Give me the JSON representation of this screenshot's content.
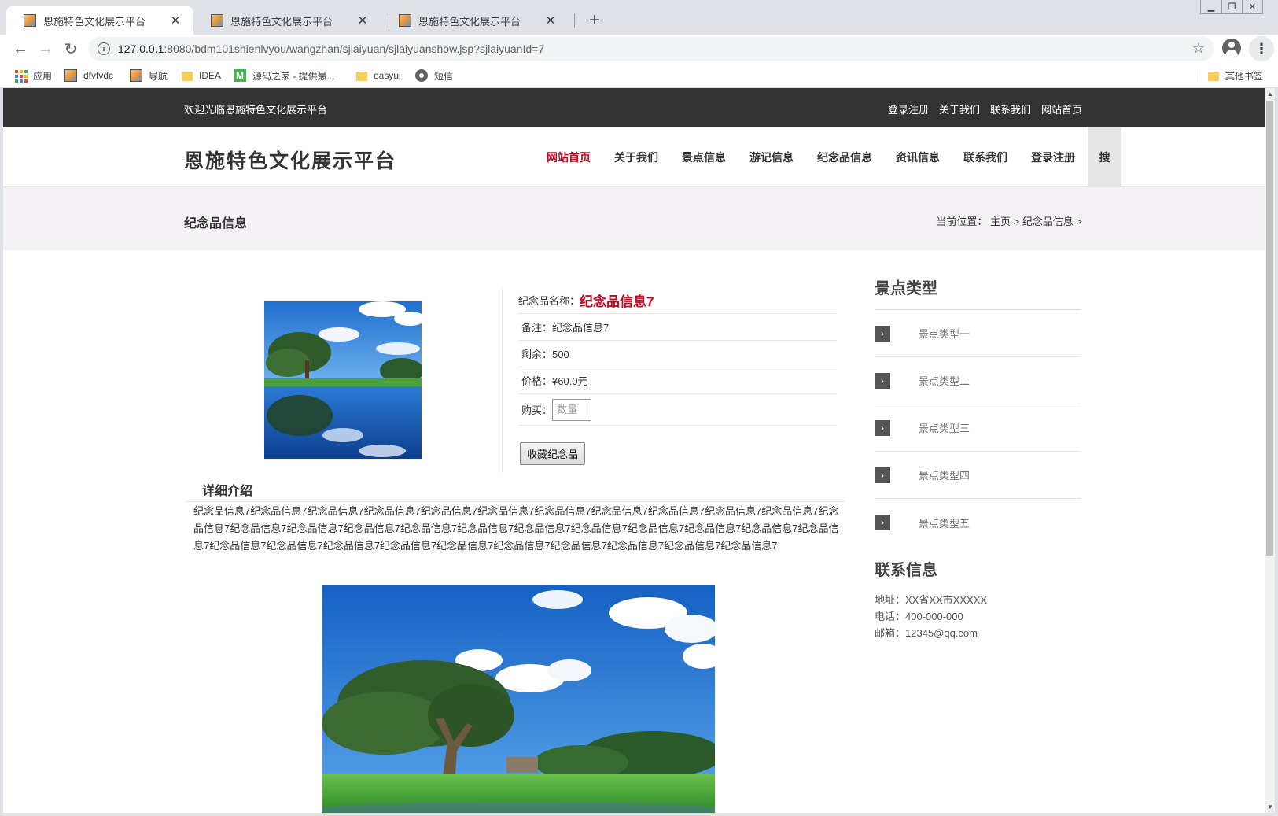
{
  "browser": {
    "tabs": [
      {
        "title": "恩施特色文化展示平台"
      },
      {
        "title": "恩施特色文化展示平台"
      },
      {
        "title": "恩施特色文化展示平台"
      }
    ],
    "url_host": "127.0.0.1",
    "url_rest": ":8080/bdm101shienlvyou/wangzhan/sjlaiyuan/sjlaiyuanshow.jsp?sjlaiyuanId=7",
    "bookmarks": [
      {
        "label": "应用",
        "icon": "apps-icon"
      },
      {
        "label": "dfvfvdc",
        "icon": "image-icon"
      },
      {
        "label": "导航",
        "icon": "image-icon"
      },
      {
        "label": "IDEA",
        "icon": "folder-icon"
      },
      {
        "label": "源码之家 - 提供最...",
        "icon": "m-icon"
      },
      {
        "label": "easyui",
        "icon": "folder-icon"
      },
      {
        "label": "短信",
        "icon": "globe-icon"
      }
    ],
    "other_bookmarks": "其他书签"
  },
  "topbar": {
    "welcome": "欢迎光临恩施特色文化展示平台",
    "links": [
      "登录注册",
      "关于我们",
      "联系我们",
      "网站首页"
    ]
  },
  "header": {
    "logo": "恩施特色文化展示平台",
    "nav": [
      "网站首页",
      "关于我们",
      "景点信息",
      "游记信息",
      "纪念品信息",
      "资讯信息",
      "联系我们",
      "登录注册"
    ],
    "active_nav": "网站首页",
    "search_label": "搜"
  },
  "banner": {
    "title": "纪念品信息",
    "breadcrumb": "当前位置： 主页 > 纪念品信息 >"
  },
  "product": {
    "name_label": "纪念品名称：",
    "name": "纪念品信息7",
    "note": "备注：纪念品信息7",
    "stock": "剩余：500",
    "price": "价格：¥60.0元",
    "buy_label": "购买：",
    "qty_placeholder": "数量",
    "fav_button": "收藏纪念品"
  },
  "detail": {
    "title": "详细介绍",
    "text": "纪念品信息7纪念品信息7纪念品信息7纪念品信息7纪念品信息7纪念品信息7纪念品信息7纪念品信息7纪念品信息7纪念品信息7纪念品信息7纪念品信息7纪念品信息7纪念品信息7纪念品信息7纪念品信息7纪念品信息7纪念品信息7纪念品信息7纪念品信息7纪念品信息7纪念品信息7纪念品信息7纪念品信息7纪念品信息7纪念品信息7纪念品信息7纪念品信息7纪念品信息7纪念品信息7纪念品信息7纪念品信息7纪念品信息7"
  },
  "sidebar": {
    "types_title": "景点类型",
    "types": [
      "景点类型一",
      "景点类型二",
      "景点类型三",
      "景点类型四",
      "景点类型五"
    ],
    "contact_title": "联系信息",
    "address": "地址：XX省XX市XXXXX",
    "phone": "电话：400-000-000",
    "email": "邮箱：12345@qq.com"
  },
  "colors": {
    "accent_red": "#d0021b",
    "topbar_bg": "#333333",
    "banner_bg": "#f4f2f4"
  }
}
